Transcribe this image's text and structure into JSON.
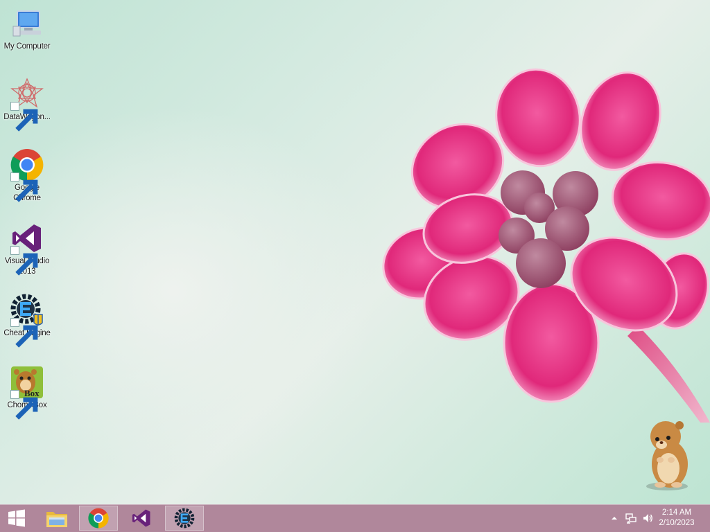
{
  "desktop": {
    "icons": [
      {
        "label": "My Computer",
        "icon": "computer-icon",
        "shortcut": false
      },
      {
        "label": "DataWagon...",
        "icon": "datawagon-icon",
        "shortcut": true
      },
      {
        "label": "Google Chrome",
        "icon": "chrome-icon",
        "shortcut": true
      },
      {
        "label": "Visual Studio 2013",
        "icon": "visual-studio-icon",
        "shortcut": true
      },
      {
        "label": "Cheat Engine",
        "icon": "cheat-engine-icon",
        "shortcut": true
      },
      {
        "label": "ChomikBox",
        "icon": "chomikbox-icon",
        "shortcut": true
      }
    ],
    "chomikbox_badge": "Box",
    "wallpaper": "pink-flower-on-mint-background"
  },
  "taskbar": {
    "background": "#b0879b",
    "start": "windows-logo-icon",
    "pinned": [
      {
        "name": "file-explorer",
        "icon": "folder-icon",
        "active": false
      },
      {
        "name": "google-chrome",
        "icon": "chrome-icon",
        "active": true
      },
      {
        "name": "visual-studio",
        "icon": "visual-studio-icon",
        "active": false
      },
      {
        "name": "cheat-engine",
        "icon": "cheat-engine-icon",
        "active": true
      }
    ],
    "tray": {
      "icons": [
        "chevron-up-icon",
        "network-icon",
        "speaker-icon"
      ],
      "time": "2:14 AM",
      "date": "2/10/2023"
    }
  }
}
